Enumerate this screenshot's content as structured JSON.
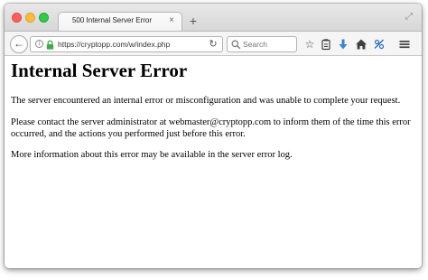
{
  "browser": {
    "tab": {
      "title": "500 Internal Server Error",
      "close_glyph": "×"
    },
    "new_tab_glyph": "+",
    "url": "https://cryptopp.com/w/index.php",
    "search": {
      "placeholder": "Search"
    }
  },
  "page": {
    "heading": "Internal Server Error",
    "paragraphs": [
      "The server encountered an internal error or misconfiguration and was unable to complete your request.",
      "Please contact the server administrator at webmaster@cryptopp.com to inform them of the time this error occurred, and the actions you performed just before this error.",
      "More information about this error may be available in the server error log."
    ]
  },
  "icons": {
    "back": "back-arrow-icon",
    "info": "info-icon",
    "lock": "lock-icon",
    "reload": "reload-icon",
    "search": "search-icon",
    "bookmark": "bookmark-star-icon",
    "reading_list": "clipboard-icon",
    "downloads": "download-icon",
    "home": "home-icon",
    "extension": "extension-icon",
    "menu": "hamburger-menu-icon"
  },
  "colors": {
    "lock": "#3fa94a",
    "download": "#3a84d8",
    "extension": "#2f6fbf",
    "traffic_close": "#fc605b",
    "traffic_min": "#fdbc40",
    "traffic_zoom": "#34c84a"
  }
}
